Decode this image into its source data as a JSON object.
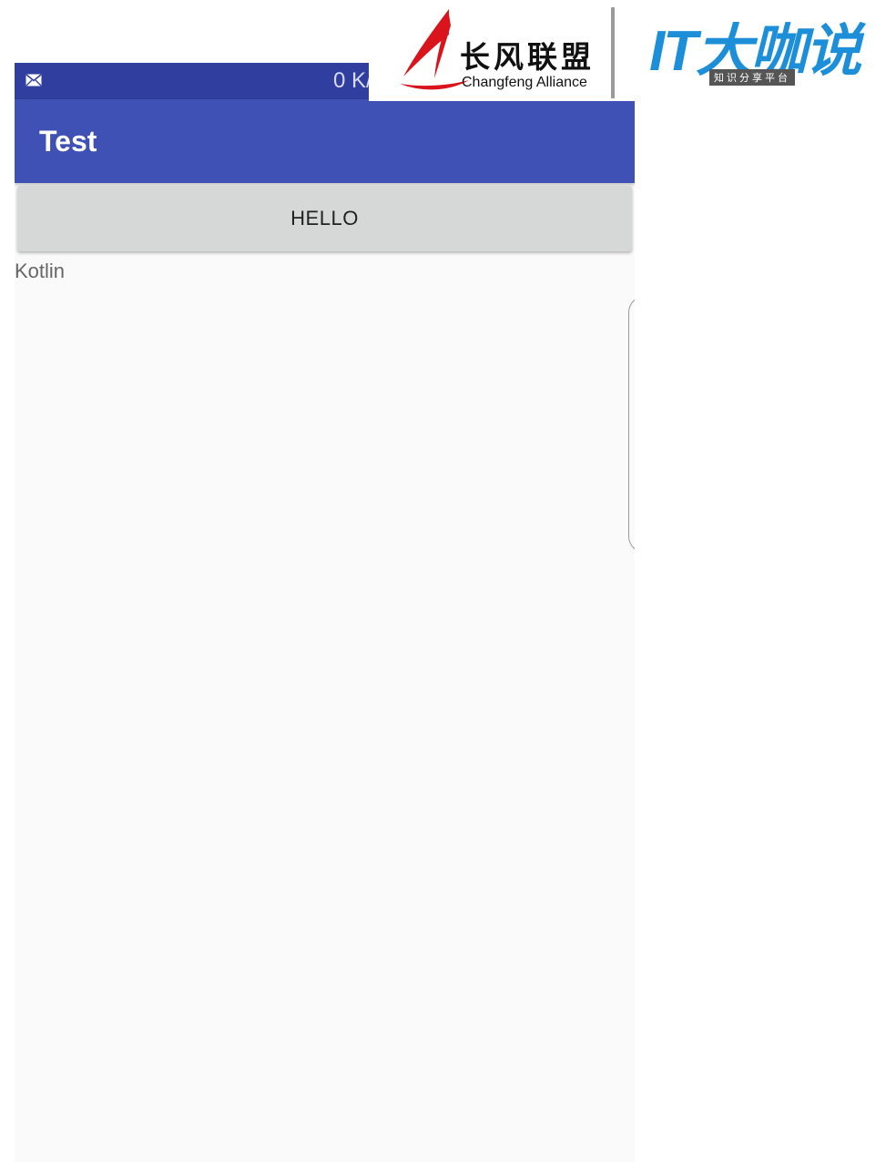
{
  "status_bar": {
    "notification_icon": "mail-icon",
    "network_speed": "0 K/"
  },
  "app_bar": {
    "title": "Test"
  },
  "main": {
    "button_label": "HELLO",
    "text_view": "Kotlin"
  },
  "watermark": {
    "changfeng_cn": "长风联盟",
    "changfeng_en": "Changfeng Alliance",
    "itdks_main": "IT大咖说",
    "itdks_tagline": "知识分享平台"
  },
  "colors": {
    "status_bar": "#303f9f",
    "app_bar": "#3f51b5",
    "button": "#d6d7d7",
    "background": "#fafafa",
    "it_logo_blue": "#1d8fd9"
  }
}
